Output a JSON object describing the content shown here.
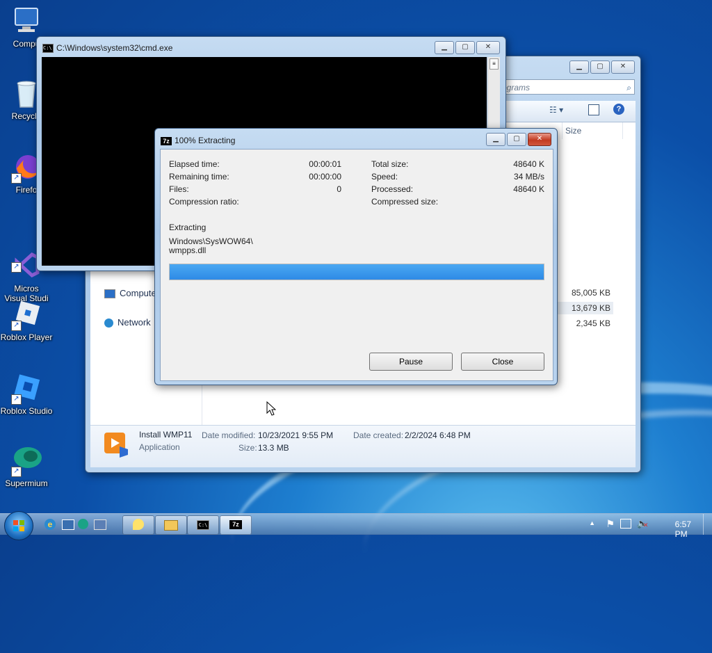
{
  "desktop": {
    "icons": [
      {
        "label": "Compu",
        "icon": "computer-icon"
      },
      {
        "label": "Recycle",
        "icon": "recycle-bin-icon"
      },
      {
        "label": "Firefo",
        "icon": "firefox-icon"
      },
      {
        "label": "Micros\nVisual Studi",
        "icon": "visual-studio-icon"
      },
      {
        "label": "Roblox Player",
        "icon": "roblox-player-icon"
      },
      {
        "label": "Roblox Studio",
        "icon": "roblox-studio-icon"
      },
      {
        "label": "Supermium",
        "icon": "supermium-icon"
      }
    ]
  },
  "explorer": {
    "search_placeholder": "rograms",
    "size_header": "Size",
    "nav": [
      {
        "label": "Compute",
        "icon": "computer-icon"
      },
      {
        "label": "Network",
        "icon": "network-icon"
      }
    ],
    "sizes": [
      "85,005 KB",
      "13,679 KB",
      "2,345 KB"
    ],
    "details": {
      "name": "Install WMP11",
      "type": "Application",
      "date_modified_label": "Date modified:",
      "date_modified": "10/23/2021 9:55 PM",
      "date_created_label": "Date created:",
      "date_created": "2/2/2024 6:48 PM",
      "size_label": "Size:",
      "size": "13.3 MB"
    }
  },
  "cmd": {
    "title": "C:\\Windows\\system32\\cmd.exe",
    "icon_text": "C:\\"
  },
  "zip": {
    "icon_text": "7z",
    "title": "100% Extracting",
    "stats_left": [
      {
        "label": "Elapsed time:",
        "value": "00:00:01"
      },
      {
        "label": "Remaining time:",
        "value": "00:00:00"
      },
      {
        "label": "Files:",
        "value": "0"
      },
      {
        "label": "Compression ratio:",
        "value": ""
      }
    ],
    "stats_right": [
      {
        "label": "Total size:",
        "value": "48640 K"
      },
      {
        "label": "Speed:",
        "value": "34 MB/s"
      },
      {
        "label": "Processed:",
        "value": "48640 K"
      },
      {
        "label": "Compressed size:",
        "value": ""
      }
    ],
    "status": "Extracting",
    "path_line1": "Windows\\SysWOW64\\",
    "path_line2": "wmpps.dll",
    "progress": 1.0,
    "pause_label": "Pause",
    "close_label": "Close"
  },
  "taskbar": {
    "time": "6:57 PM",
    "apps": [
      "ie-icon",
      "server-manager-icon",
      "network-globe-icon",
      "computer-management-icon"
    ],
    "buttons": [
      "sticky-notes-icon",
      "explorer-icon",
      "cmd-icon",
      "7zip-icon"
    ],
    "cmd_btn_text": "C:\\",
    "zip_btn_text": "7z"
  },
  "colors": {
    "accent": "#2e8ae6",
    "desktop": "#0b4fa8"
  }
}
